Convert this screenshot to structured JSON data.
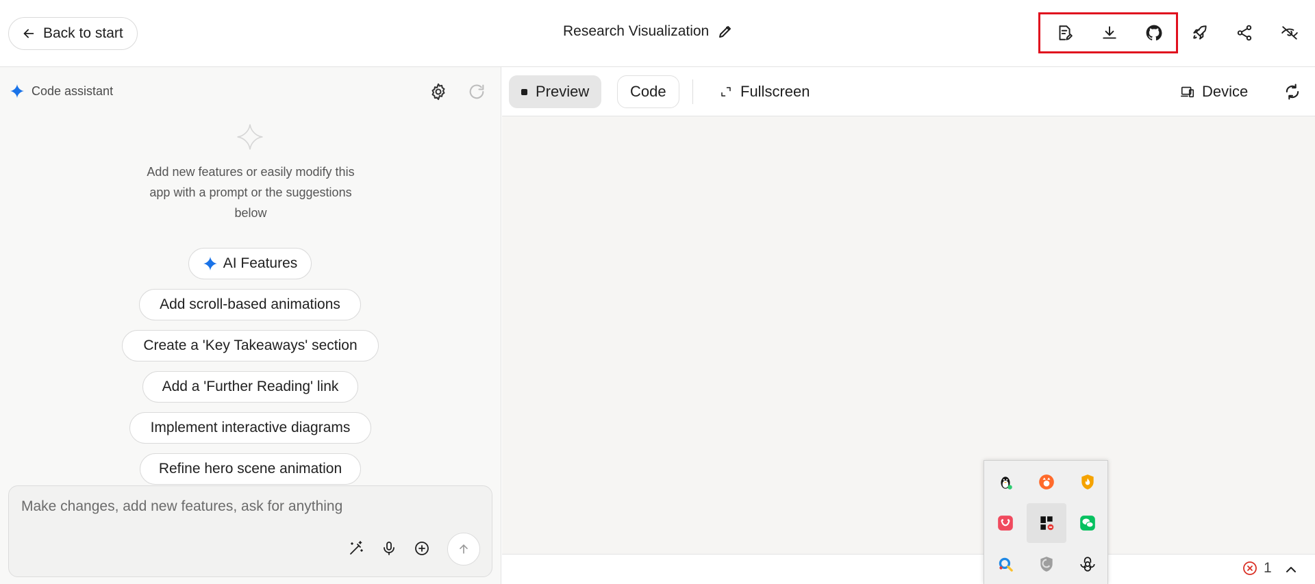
{
  "header": {
    "back_label": "Back to start",
    "title": "Research Visualization",
    "actions": [
      "save-edit",
      "download",
      "github",
      "deploy",
      "share",
      "hide"
    ]
  },
  "assistant": {
    "label": "Code assistant",
    "intro": "Add new features or easily modify this app with a prompt or the suggestions below",
    "suggestions": [
      "AI Features",
      "Add scroll-based animations",
      "Create a 'Key Takeaways' section",
      "Add a 'Further Reading' link",
      "Implement interactive diagrams",
      "Refine hero scene animation"
    ],
    "input_placeholder": "Make changes, add new features, ask for anything"
  },
  "preview_toolbar": {
    "preview_label": "Preview",
    "code_label": "Code",
    "fullscreen_label": "Fullscreen",
    "device_label": "Device"
  },
  "status": {
    "error_count": "1"
  },
  "colors": {
    "accent_blue": "#1a73e8",
    "highlight_red": "#e0101e",
    "error_red": "#d93025"
  }
}
